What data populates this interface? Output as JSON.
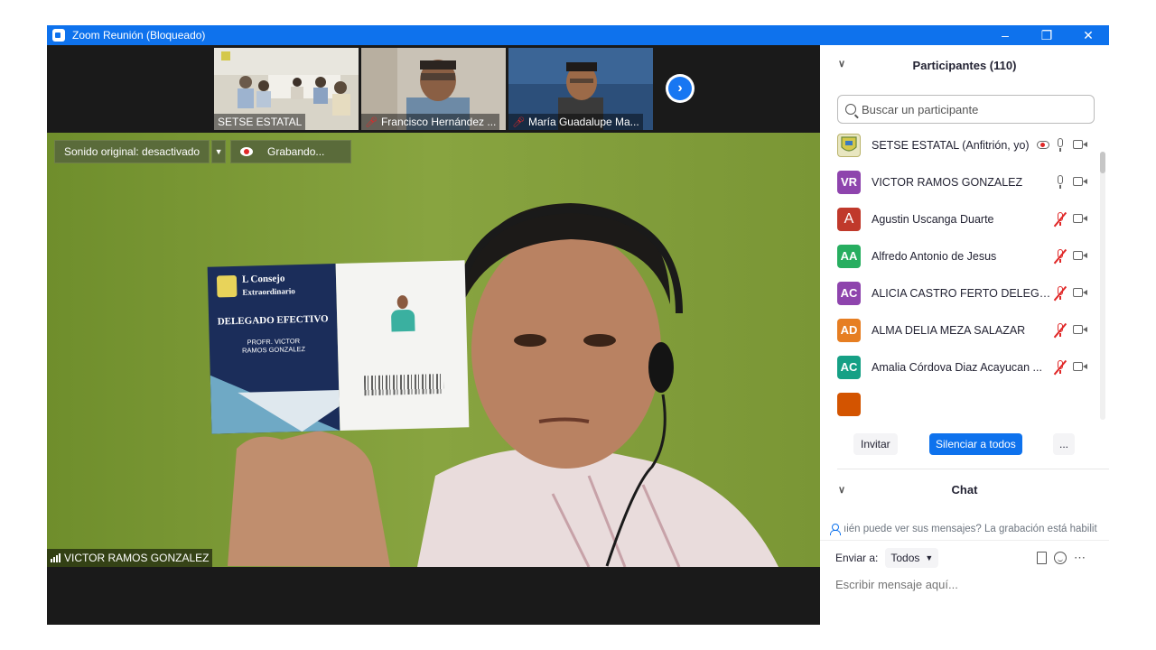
{
  "window": {
    "title": "Zoom Reunión (Bloqueado)"
  },
  "thumbnails": [
    {
      "label": "SETSE ESTATAL",
      "muted": false
    },
    {
      "label": "Francisco Hernández ...",
      "muted": true
    },
    {
      "label": "María Guadalupe Ma...",
      "muted": true
    }
  ],
  "main": {
    "original_sound": "Sonido original: desactivado",
    "recording": "Grabando...",
    "speaker_name": "VICTOR RAMOS GONZALEZ",
    "card": {
      "title_line1": "L Consejo",
      "title_line2": "Extraordinario",
      "role": "DELEGADO EFECTIVO",
      "name_line1": "PROFR. VICTOR",
      "name_line2": "RAMOS GONZALEZ"
    }
  },
  "participants": {
    "header": "Participantes (110)",
    "search_placeholder": "Buscar un participante",
    "items": [
      {
        "initials": "",
        "name": "SETSE ESTATAL (Anfitrión, yo)",
        "color": "#c9c24a",
        "muted": false,
        "recording": true
      },
      {
        "initials": "VR",
        "name": "VICTOR RAMOS GONZALEZ",
        "color": "#8e44ad",
        "muted": false,
        "recording": false
      },
      {
        "initials": "A",
        "name": "Agustin Uscanga Duarte",
        "color": "#c0392b",
        "muted": true,
        "recording": false
      },
      {
        "initials": "AA",
        "name": "Alfredo Antonio de Jesus",
        "color": "#27ae60",
        "muted": true,
        "recording": false
      },
      {
        "initials": "AC",
        "name": "ALICIA CASTRO FERTO DELEGAC...",
        "color": "#8e44ad",
        "muted": true,
        "recording": false
      },
      {
        "initials": "AD",
        "name": "ALMA DELIA MEZA SALAZAR",
        "color": "#e67e22",
        "muted": true,
        "recording": false
      },
      {
        "initials": "AC",
        "name": "Amalia Córdova Diaz Acayucan ...",
        "color": "#16a085",
        "muted": true,
        "recording": false
      }
    ],
    "invite_label": "Invitar",
    "mute_all_label": "Silenciar a todos",
    "more_label": "..."
  },
  "chat": {
    "header": "Chat",
    "notice": "ıién puede ver sus mensajes? La grabación está habilit",
    "send_to_label": "Enviar a:",
    "send_to_value": "Todos",
    "input_placeholder": "Escribir mensaje aquí..."
  }
}
